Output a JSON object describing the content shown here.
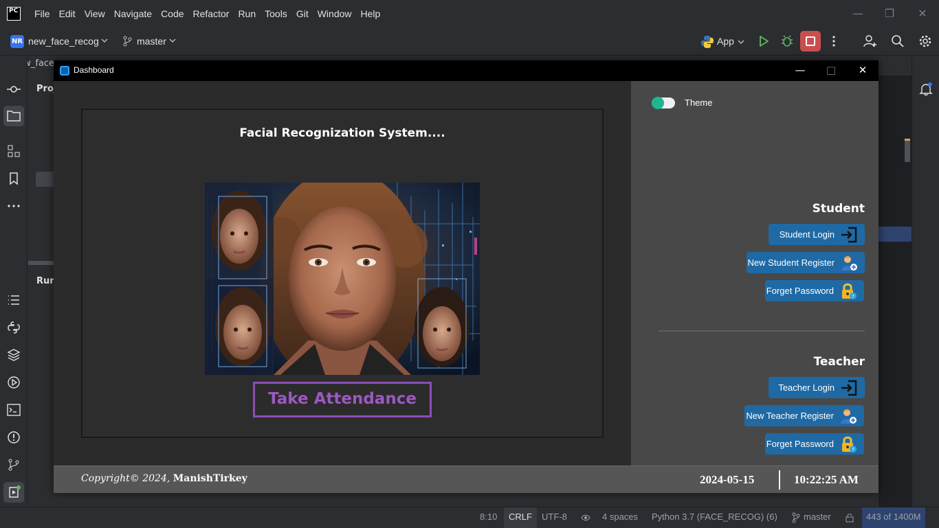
{
  "ide": {
    "logo_text": "PC",
    "menu": [
      "File",
      "Edit",
      "View",
      "Navigate",
      "Code",
      "Refactor",
      "Run",
      "Tools",
      "Git",
      "Window",
      "Help"
    ],
    "project_badge": "NR",
    "project_name": "new_face_recog",
    "branch": "master",
    "run_config": "App",
    "project_tab": "new_face",
    "project_panel_label": "Proj",
    "run_panel_label": "Run"
  },
  "statusbar": {
    "position": "8:10",
    "line_sep": "CRLF",
    "encoding": "UTF-8",
    "indent": "4 spaces",
    "interpreter": "Python 3.7 (FACE_RECOG) (6)",
    "branch": "master",
    "memory": "443 of 1400M"
  },
  "app": {
    "title": "Dashboard",
    "system_title": "Facial Recognization System....",
    "attendance_button": "Take Attendance",
    "theme_label": "Theme",
    "student": {
      "title": "Student",
      "login": "Student Login",
      "register": "New Student Register",
      "forget": "Forget Password"
    },
    "teacher": {
      "title": "Teacher",
      "login": "Teacher Login",
      "register": "New Teacher Register",
      "forget": "Forget Password"
    },
    "footer": {
      "copyright": "Copyright© 2024,",
      "author": "ManishTirkey",
      "date": "2024-05-15",
      "time": "10:22:25 AM"
    }
  },
  "colors": {
    "accent_button": "#1f6aa5",
    "attendance_purple": "#9b59c0",
    "toggle_on": "#1fb58f"
  }
}
